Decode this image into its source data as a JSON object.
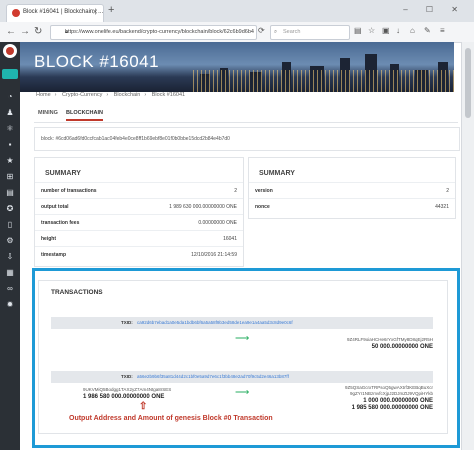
{
  "browser": {
    "tab_title": "Block #16041 | Blockchain | ...",
    "new_tab": "+",
    "url": "https://www.onelife.eu/backend/crypto-currency/blockchain/block/62c6b9d6b4",
    "search_placeholder": "Search",
    "window_controls": "– ☐ ✕"
  },
  "header": {
    "title": "BLOCK #16041"
  },
  "breadcrumb": [
    "Home",
    "Crypto-Currency",
    "Blockchain",
    "Block #16041"
  ],
  "tabs": [
    {
      "label": "MINING"
    },
    {
      "label": "BLOCKCHAIN"
    }
  ],
  "block_hash_line": "block: #6cd06ad6fd0ccfcab1ac04feb4e0ce8ff1b69ebf8e01f0b0bbe15dcd2b84e4b7d0",
  "summary_left": {
    "title": "SUMMARY",
    "rows": [
      {
        "label": "number of transactions",
        "value": "2"
      },
      {
        "label": "output total",
        "value": "1 989 630 000.00000000 ONE"
      },
      {
        "label": "transaction fees",
        "value": "0.00000000 ONE"
      },
      {
        "label": "height",
        "value": "16041"
      },
      {
        "label": "timestamp",
        "value": "12/10/2016 21:14:59"
      }
    ]
  },
  "summary_right": {
    "title": "SUMMARY",
    "rows": [
      {
        "label": "version",
        "value": "2"
      },
      {
        "label": "nonce",
        "value": "44321"
      }
    ]
  },
  "transactions": {
    "title": "TRANSACTIONS",
    "tx1": {
      "txid_label": "TXID:",
      "txid": "ca92d6b7ebad1a0e5da1bdb6bf6a5a58f9b3ed58de1ea9e1a4aa5d3c8d9e0c6f",
      "to_address": "9Z4RLF9oiaHCHe6rYxGfTMy8D8qEj2R5H",
      "to_amount": "50 000.00000000 ONE"
    },
    "tx2": {
      "txid_label": "TXID:",
      "txid": "a56e2b9b6f35a81d44d2c1bf0e5a9d7e6c1f3bb48e2ad70f9c5d2e46a13b87ff",
      "from_address": "9UKVMiQ5Bodgg1TAX2yZ7Am4Ntga8rSES",
      "from_amount": "1 986 580 000.00000000 ONE",
      "to_address_1": "9Z5QSaGcrxTRPsoQ5gwAXtrf3KEBqBuXcr",
      "to_amount_1": "1 000 000.00000000 ONE",
      "to_address_2": "9gZYr1NBzmvfcXjpJ2DJmZtJ9VQpiHYkb",
      "to_amount_2": "1 985 580 000.00000000 ONE"
    },
    "annotation": "Output Address and Amount of genesis Block #0 Transaction"
  }
}
